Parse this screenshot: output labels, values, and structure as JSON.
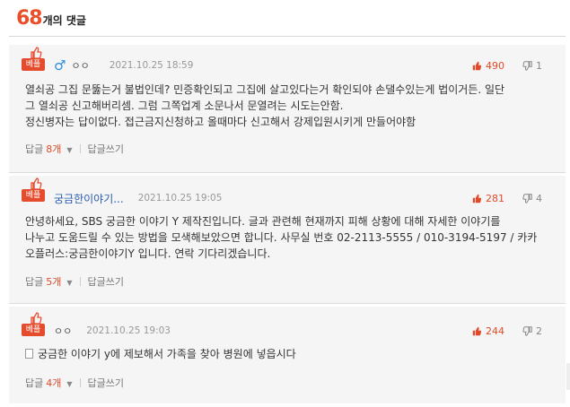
{
  "header": {
    "count": "68",
    "count_suffix": "개의 댓글"
  },
  "best_label": "베플",
  "comments": [
    {
      "author": "ㅇㅇ",
      "gender_icon": "♂",
      "date": "2021.10.25 18:59",
      "upvotes": "490",
      "downvotes": "1",
      "body": [
        "열쇠공 그집 문뚫는거 불법인데? 민증확인되고 그집에 살고있다는거 확인되야 손댈수있는게 법이거든. 일단",
        "그 열쇠공 신고해버리셈. 그럼 그쪽업계 소문나서 문열려는 시도는안함.",
        "정신병자는 답이없다. 접근금지신청하고 올때마다 신고해서 강제입원시키게 만들어야함"
      ],
      "reply_label": "답글",
      "reply_count": "8개",
      "write_reply": "답글쓰기"
    },
    {
      "author": "궁금한이야기...",
      "date": "2021.10.25 19:05",
      "upvotes": "281",
      "downvotes": "4",
      "body": [
        "안녕하세요, SBS 궁금한 이야기 Y 제작진입니다. 글과 관련해 현재까지 피해 상황에 대해 자세한 이야기를",
        "나누고 도움드릴 수 있는 방법을 모색해보았으면 합니다. 사무실 번호 02-2113-5555 / 010-3194-5197 / 카카",
        "오플러스:궁금한이야기Y 입니다. 연락 기다리겠습니다."
      ],
      "reply_label": "답글",
      "reply_count": "5개",
      "write_reply": "답글쓰기"
    },
    {
      "author": "ㅇㅇ",
      "date": "2021.10.25 19:03",
      "upvotes": "244",
      "downvotes": "2",
      "body": [
        "궁금한 이야기 y에 제보해서 가족을 찾아 병원에 넣읍시다"
      ],
      "reply_label": "답글",
      "reply_count": "4개",
      "write_reply": "답글쓰기"
    }
  ],
  "colors": {
    "accent": "#e8502c",
    "link": "#2a5db0",
    "background": "#f5f5f5"
  }
}
